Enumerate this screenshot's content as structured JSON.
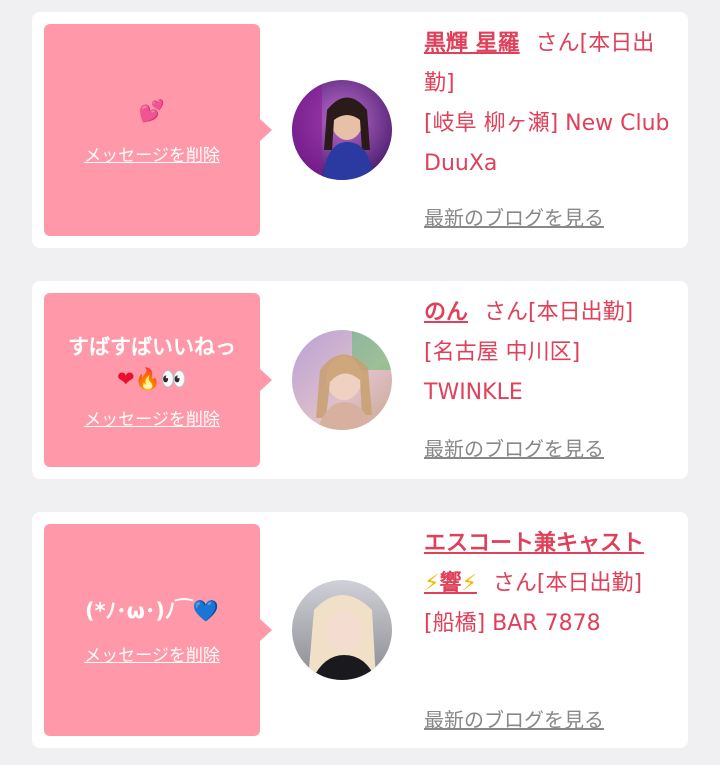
{
  "cards": [
    {
      "message_emoji": "💕",
      "delete_label": "メッセージを削除",
      "name": "黒輝 星羅",
      "honorific": "さん[本日出勤]",
      "location": "[岐阜 柳ヶ瀬] New Club DuuXa",
      "blog_link": "最新のブログを見る"
    },
    {
      "message_text": "すばすばいいねっ",
      "message_emoji_1": "❤",
      "message_emoji_2": "🔥",
      "message_emoji_3": "👀",
      "delete_label": "メッセージを削除",
      "name": "のん",
      "honorific": "さん[本日出勤]",
      "location": "[名古屋 中川区] TWINKLE",
      "blog_link": "最新のブログを見る"
    },
    {
      "message_text": "(*ﾉ･ω･)ﾉ⁀",
      "message_emoji": "💙",
      "delete_label": "メッセージを削除",
      "name_prefix": "エスコート兼キャスト",
      "name_bolt_1": "⚡",
      "name_core": "響",
      "name_bolt_2": "⚡",
      "honorific": "さん[本日出勤]",
      "location": "[船橋] BAR 7878",
      "blog_link": "最新のブログを見る"
    }
  ]
}
